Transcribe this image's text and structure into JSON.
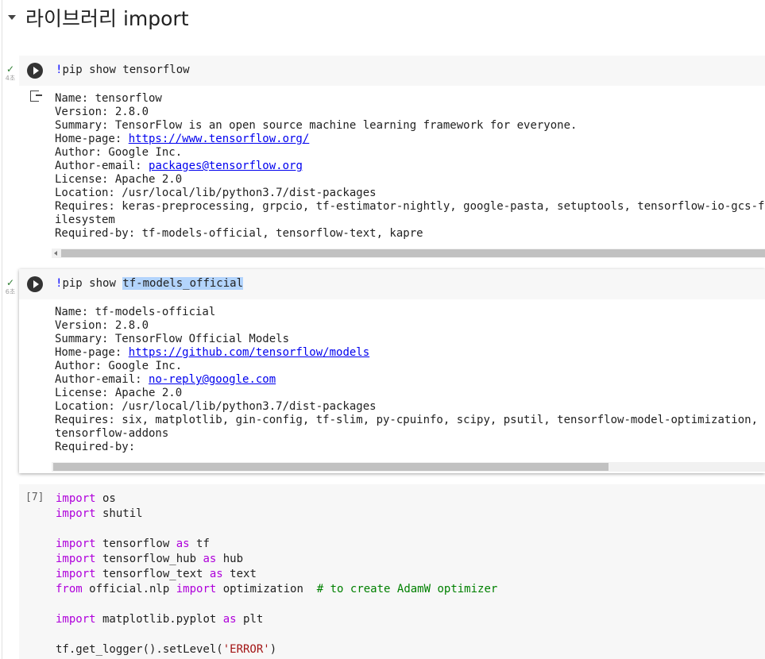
{
  "section": {
    "title": "라이브러리 import"
  },
  "cell1": {
    "status": "✓",
    "time": "4초",
    "code_prefix": "!",
    "code": "pip show tensorflow",
    "output": [
      {
        "pre": "Name: tensorflow"
      },
      {
        "pre": "Version: 2.8.0"
      },
      {
        "pre": "Summary: TensorFlow is an open source machine learning framework for everyone."
      },
      {
        "pre": "Home-page: ",
        "link": "https://www.tensorflow.org/"
      },
      {
        "pre": "Author: Google Inc."
      },
      {
        "pre": "Author-email: ",
        "link": "packages@tensorflow.org"
      },
      {
        "pre": "License: Apache 2.0"
      },
      {
        "pre": "Location: /usr/local/lib/python3.7/dist-packages"
      },
      {
        "pre": "Requires: keras-preprocessing, grpcio, tf-estimator-nightly, google-pasta, setuptools, tensorflow-io-gcs-filesystem"
      },
      {
        "pre": "Required-by: tf-models-official, tensorflow-text, kapre"
      }
    ]
  },
  "cell2": {
    "status": "✓",
    "time": "6초",
    "code_prefix": "!",
    "code_plain": "pip show ",
    "code_selected": "tf-models_official",
    "output": [
      {
        "pre": "Name: tf-models-official"
      },
      {
        "pre": "Version: 2.8.0"
      },
      {
        "pre": "Summary: TensorFlow Official Models"
      },
      {
        "pre": "Home-page: ",
        "link": "https://github.com/tensorflow/models"
      },
      {
        "pre": "Author: Google Inc."
      },
      {
        "pre": "Author-email: ",
        "link": "no-reply@google.com"
      },
      {
        "pre": "License: Apache 2.0"
      },
      {
        "pre": "Location: /usr/local/lib/python3.7/dist-packages"
      },
      {
        "pre": "Requires: six, matplotlib, gin-config, tf-slim, py-cpuinfo, scipy, psutil, tensorflow-model-optimization, tensorflow-addons"
      },
      {
        "pre": "Required-by:"
      }
    ]
  },
  "cell3": {
    "count": "[7]",
    "lines": [
      [
        [
          "kw",
          "import"
        ],
        [
          "",
          " os"
        ]
      ],
      [
        [
          "kw",
          "import"
        ],
        [
          "",
          " shutil"
        ]
      ],
      [],
      [
        [
          "kw",
          "import"
        ],
        [
          "",
          " tensorflow "
        ],
        [
          "kw",
          "as"
        ],
        [
          "",
          " tf"
        ]
      ],
      [
        [
          "kw",
          "import"
        ],
        [
          "",
          " tensorflow_hub "
        ],
        [
          "kw",
          "as"
        ],
        [
          "",
          " hub"
        ]
      ],
      [
        [
          "kw",
          "import"
        ],
        [
          "",
          " tensorflow_text "
        ],
        [
          "kw",
          "as"
        ],
        [
          "",
          " text"
        ]
      ],
      [
        [
          "kw",
          "from"
        ],
        [
          "",
          " official.nlp "
        ],
        [
          "kw",
          "import"
        ],
        [
          "",
          " optimization  "
        ],
        [
          "cm",
          "# to create AdamW optimizer"
        ]
      ],
      [],
      [
        [
          "kw",
          "import"
        ],
        [
          "",
          " matplotlib.pyplot "
        ],
        [
          "kw",
          "as"
        ],
        [
          "",
          " plt"
        ]
      ],
      [],
      [
        [
          "",
          "tf.get_logger().setLevel("
        ],
        [
          "st",
          "'ERROR'"
        ],
        [
          "",
          ")"
        ]
      ]
    ]
  }
}
